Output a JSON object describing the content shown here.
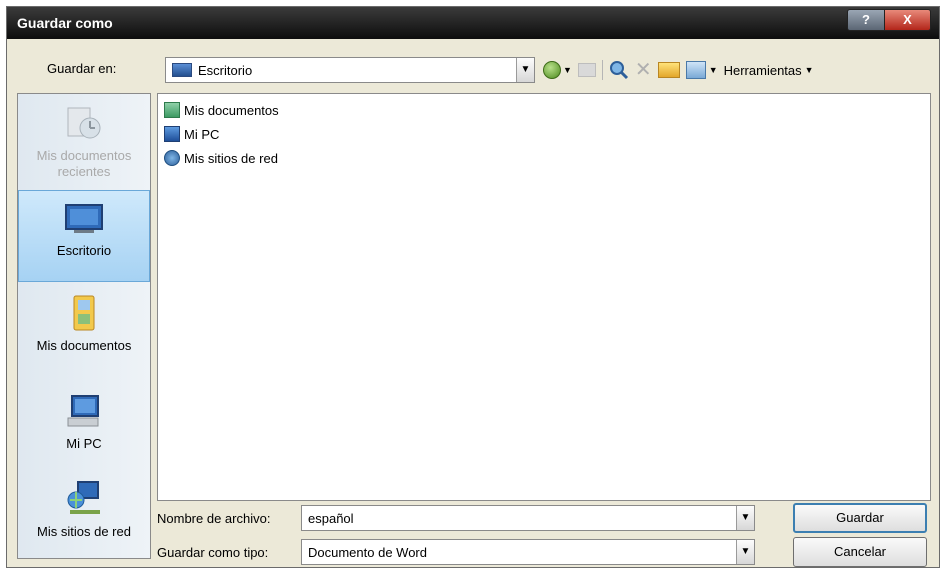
{
  "window": {
    "title": "Guardar como"
  },
  "titlebar_buttons": {
    "help": "?",
    "close": "X"
  },
  "save_in": {
    "label": "Guardar en:",
    "value": "Escritorio"
  },
  "toolbar": {
    "tools_label": "Herramientas"
  },
  "places": [
    {
      "label": "Mis documentos recientes",
      "icon": "recent-documents-icon",
      "state": "disabled"
    },
    {
      "label": "Escritorio",
      "icon": "desktop-icon",
      "state": "selected"
    },
    {
      "label": "Mis documentos",
      "icon": "my-documents-icon",
      "state": "normal"
    },
    {
      "label": "Mi PC",
      "icon": "my-computer-icon",
      "state": "normal"
    },
    {
      "label": "Mis sitios de red",
      "icon": "network-places-icon",
      "state": "normal"
    }
  ],
  "files": [
    {
      "name": "Mis documentos",
      "icon": "folder-icon"
    },
    {
      "name": "Mi PC",
      "icon": "computer-icon"
    },
    {
      "name": "Mis sitios de red",
      "icon": "network-icon"
    }
  ],
  "filename": {
    "label": "Nombre de archivo:",
    "value": "español"
  },
  "filetype": {
    "label": "Guardar como tipo:",
    "value": "Documento de Word"
  },
  "buttons": {
    "save": "Guardar",
    "cancel": "Cancelar"
  },
  "colors": {
    "titlebar": "#1a1a1a",
    "selected_place": "#a6d2f3",
    "dialog_bg": "#ece9d8"
  }
}
